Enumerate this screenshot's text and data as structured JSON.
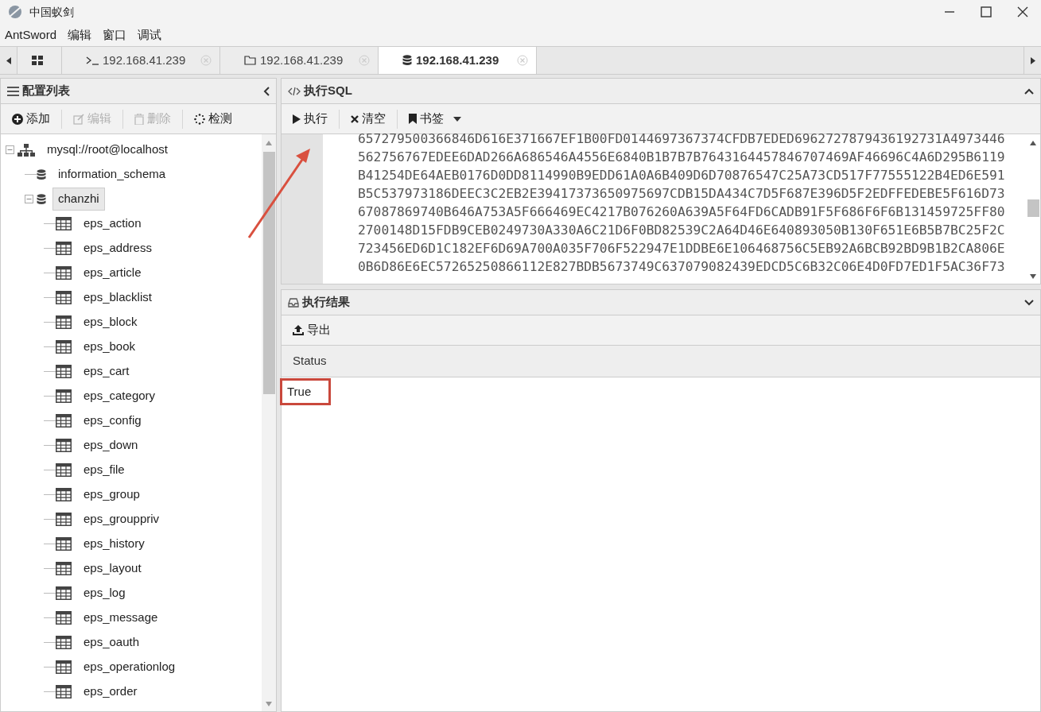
{
  "window": {
    "title": "中国蚁剑"
  },
  "menu": [
    "AntSword",
    "编辑",
    "窗口",
    "调试"
  ],
  "tabs": [
    {
      "kind": "grid",
      "selected": false
    },
    {
      "kind": "terminal",
      "label": "192.168.41.239",
      "selected": false
    },
    {
      "kind": "folder",
      "label": "192.168.41.239",
      "selected": false
    },
    {
      "kind": "database",
      "label": "192.168.41.239",
      "selected": true
    }
  ],
  "sidebar": {
    "title": "配置列表",
    "toolbar": [
      {
        "kind": "add",
        "label": "添加",
        "disabled": false
      },
      {
        "kind": "edit",
        "label": "编辑",
        "disabled": true
      },
      {
        "kind": "delete",
        "label": "删除",
        "disabled": true
      },
      {
        "kind": "check",
        "label": "检测",
        "disabled": false
      }
    ],
    "tree": [
      {
        "kind": "server",
        "label": "mysql://root@localhost",
        "expanded": true,
        "selected": false,
        "children": [
          {
            "kind": "database",
            "label": "information_schema",
            "selected": false
          },
          {
            "kind": "database",
            "label": "chanzhi",
            "expanded": true,
            "selected": true,
            "children": [
              {
                "kind": "table",
                "label": "eps_action",
                "selected": false
              },
              {
                "kind": "table",
                "label": "eps_address",
                "selected": false
              },
              {
                "kind": "table",
                "label": "eps_article",
                "selected": false
              },
              {
                "kind": "table",
                "label": "eps_blacklist",
                "selected": false
              },
              {
                "kind": "table",
                "label": "eps_block",
                "selected": false
              },
              {
                "kind": "table",
                "label": "eps_book",
                "selected": false
              },
              {
                "kind": "table",
                "label": "eps_cart",
                "selected": false
              },
              {
                "kind": "table",
                "label": "eps_category",
                "selected": false
              },
              {
                "kind": "table",
                "label": "eps_config",
                "selected": false
              },
              {
                "kind": "table",
                "label": "eps_down",
                "selected": false
              },
              {
                "kind": "table",
                "label": "eps_file",
                "selected": false
              },
              {
                "kind": "table",
                "label": "eps_group",
                "selected": false
              },
              {
                "kind": "table",
                "label": "eps_grouppriv",
                "selected": false
              },
              {
                "kind": "table",
                "label": "eps_history",
                "selected": false
              },
              {
                "kind": "table",
                "label": "eps_layout",
                "selected": false
              },
              {
                "kind": "table",
                "label": "eps_log",
                "selected": false
              },
              {
                "kind": "table",
                "label": "eps_message",
                "selected": false
              },
              {
                "kind": "table",
                "label": "eps_oauth",
                "selected": false
              },
              {
                "kind": "table",
                "label": "eps_operationlog",
                "selected": false
              },
              {
                "kind": "table",
                "label": "eps_order",
                "selected": false
              }
            ]
          }
        ]
      }
    ]
  },
  "sql_panel": {
    "title": "执行SQL",
    "toolbar": [
      {
        "kind": "run",
        "label": "执行"
      },
      {
        "kind": "clear",
        "label": "清空"
      },
      {
        "kind": "bookmark",
        "label": "书签"
      }
    ],
    "editor_lines": [
      "657279500366846D616E371667EF1B00FD0144697367374CFDB7EDED6962727879436192731A4973446",
      "562756767EDEE6DAD266A686546A4556E6840B1B7B7B7643164457846707469AF46696C4A6D295B6119",
      "B41254DE64AEB0176D0DD8114990B9EDD61A0A6B409D6D70876547C25A73CD517F77555122B4ED6E591",
      "B5C537973186DEEC3C2EB2E39417373650975697CDB15DA434C7D5F687E396D5F2EDFFEDEBE5F616D73",
      "67087869740B646A753A5F666469EC4217B076260A639A5F64FD6CADB91F5F686F6F6B131459725FF80",
      "2700148D15FDB9CEB0249730A330A6C21D6F0BD82539C2A64D46E640893050B130F651E6B5B7BC25F2C",
      "723456ED6D1C182EF6D69A700A035F706F522947E1DDBE6E106468756C5EB92A6BCB92BD9B1B2CA806E",
      "0B6D86E6EC57265250866112E827BDB5673749C637079082439EDCD5C6B32C06E4D0FD7ED1F5AC36F73"
    ]
  },
  "result_panel": {
    "title": "执行结果",
    "toolbar": [
      {
        "kind": "export",
        "label": "导出"
      }
    ],
    "table": {
      "columns": [
        "Status"
      ],
      "rows": [
        [
          "True"
        ]
      ]
    }
  }
}
